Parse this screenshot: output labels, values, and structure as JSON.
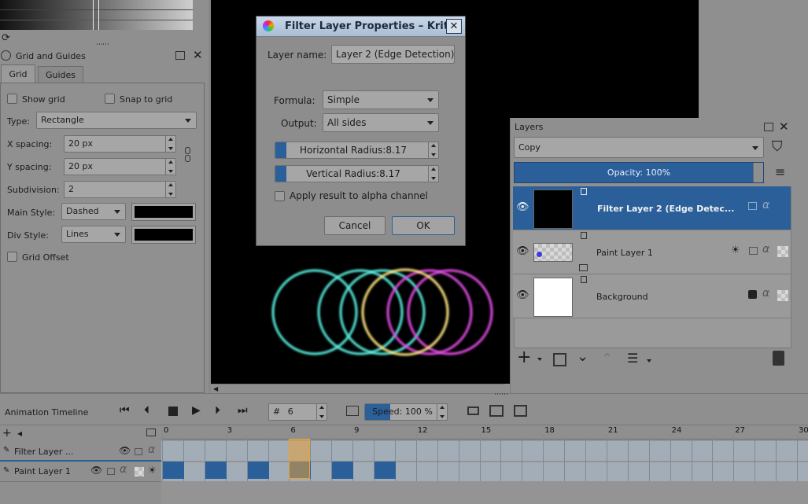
{
  "grid_panel": {
    "title": "Grid and Guides",
    "tabs": [
      "Grid",
      "Guides"
    ],
    "show_grid": "Show grid",
    "snap_to_grid": "Snap to grid",
    "type_label": "Type:",
    "type_value": "Rectangle",
    "x_spacing_label": "X spacing:",
    "x_spacing_value": "20 px",
    "y_spacing_label": "Y spacing:",
    "y_spacing_value": "20 px",
    "subdivision_label": "Subdivision:",
    "subdivision_value": "2",
    "main_style_label": "Main Style:",
    "main_style_value": "Dashed",
    "div_style_label": "Div Style:",
    "div_style_value": "Lines",
    "grid_offset": "Grid Offset",
    "main_color": "#000000",
    "div_color": "#000000"
  },
  "dialog": {
    "title": "Filter Layer Properties – Krita",
    "layer_name_label": "Layer name:",
    "layer_name_value": "Layer 2 (Edge Detection)",
    "formula_label": "Formula:",
    "formula_value": "Simple",
    "output_label": "Output:",
    "output_value": "All sides",
    "horizontal_radius": "Horizontal Radius:8.17",
    "vertical_radius": "Vertical Radius:8.17",
    "apply_alpha": "Apply result to alpha channel",
    "cancel_label": "Cancel",
    "ok_label": "OK"
  },
  "layers_panel": {
    "title": "Layers",
    "blend_mode": "Copy",
    "opacity": "Opacity:  100%",
    "layers": [
      {
        "name": "Filter Layer 2 (Edge Detec..."
      },
      {
        "name": "Paint Layer 1"
      },
      {
        "name": "Background"
      }
    ]
  },
  "timeline": {
    "title": "Animation Timeline",
    "frame_prefix": "#",
    "frame_value": "6",
    "speed_label": "Speed: 100 %",
    "speed_fraction": 0.35,
    "tracks": [
      "Filter Layer ...",
      "Paint Layer 1"
    ],
    "ticks": [
      "0",
      "3",
      "6",
      "9",
      "12",
      "15",
      "18",
      "21",
      "24",
      "27",
      "30"
    ],
    "keyframes": [
      0,
      2,
      4,
      6,
      8,
      10
    ],
    "current_frame": 6,
    "accent": "#2b5f9a"
  }
}
